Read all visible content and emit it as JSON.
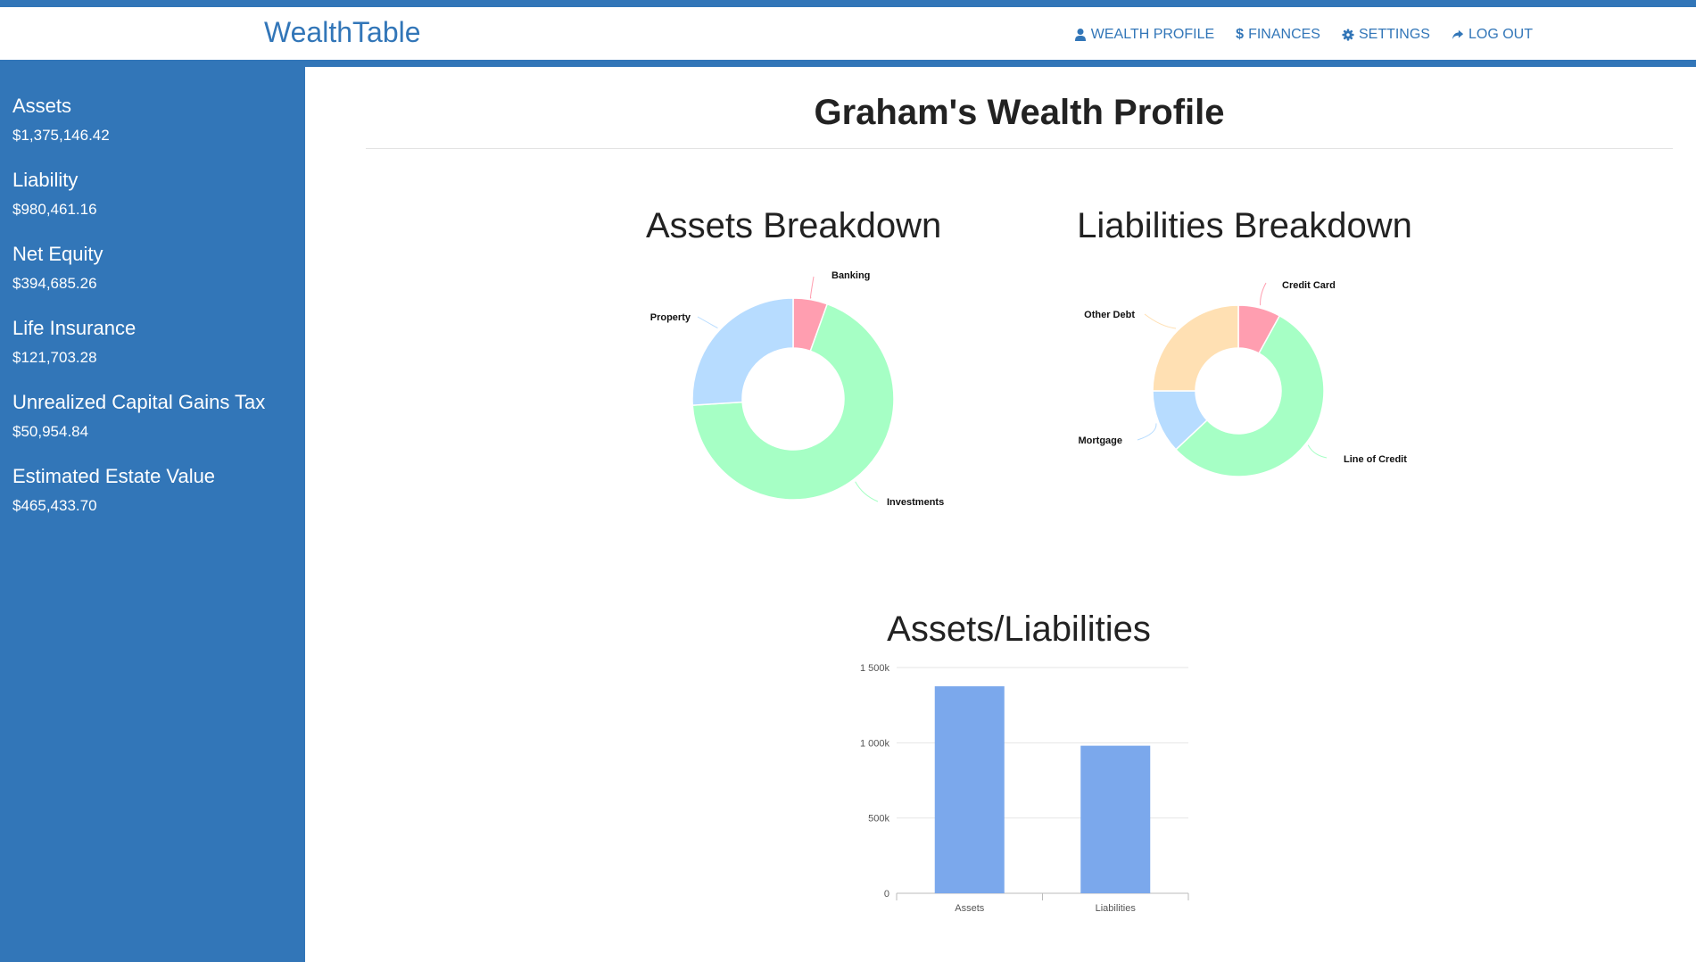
{
  "app": {
    "brand": "WealthTable"
  },
  "nav": {
    "wealth_profile": "WEALTH PROFILE",
    "finances": "FINANCES",
    "settings": "SETTINGS",
    "logout": "LOG OUT"
  },
  "sidebar": {
    "items": [
      {
        "label": "Assets",
        "value": "$1,375,146.42"
      },
      {
        "label": "Liability",
        "value": "$980,461.16"
      },
      {
        "label": "Net Equity",
        "value": "$394,685.26"
      },
      {
        "label": "Life Insurance",
        "value": "$121,703.28"
      },
      {
        "label": "Unrealized Capital Gains Tax",
        "value": "$50,954.84"
      },
      {
        "label": "Estimated Estate Value",
        "value": "$465,433.70"
      }
    ]
  },
  "page": {
    "title": "Graham's Wealth Profile"
  },
  "colors": {
    "brand": "#3276b8",
    "pink": "#ff9eb0",
    "green": "#a6ffc5",
    "light_blue": "#b7dcff",
    "peach": "#ffe0b3",
    "bar": "#7ba8ec"
  },
  "chart_data": [
    {
      "type": "pie",
      "title": "Assets Breakdown",
      "labels": [
        "Banking",
        "Investments",
        "Property"
      ],
      "values": [
        5.5,
        68.5,
        26.0
      ],
      "colors": [
        "#ff9eb0",
        "#a6ffc5",
        "#b7dcff"
      ]
    },
    {
      "type": "pie",
      "title": "Liabilities Breakdown",
      "labels": [
        "Credit Card",
        "Line of Credit",
        "Mortgage",
        "Other Debt"
      ],
      "values": [
        8.0,
        55.0,
        12.0,
        25.0
      ],
      "colors": [
        "#ff9eb0",
        "#a6ffc5",
        "#b7dcff",
        "#ffe0b3"
      ]
    },
    {
      "type": "bar",
      "title": "Assets/Liabilities",
      "categories": [
        "Assets",
        "Liabilities"
      ],
      "values": [
        1375146.42,
        980461.16
      ],
      "ylim": [
        0,
        1500000
      ],
      "yticks": [
        0,
        500000,
        1000000,
        1500000
      ],
      "ytick_labels": [
        "0",
        "500k",
        "1 000k",
        "1 500k"
      ],
      "grid": true
    }
  ]
}
